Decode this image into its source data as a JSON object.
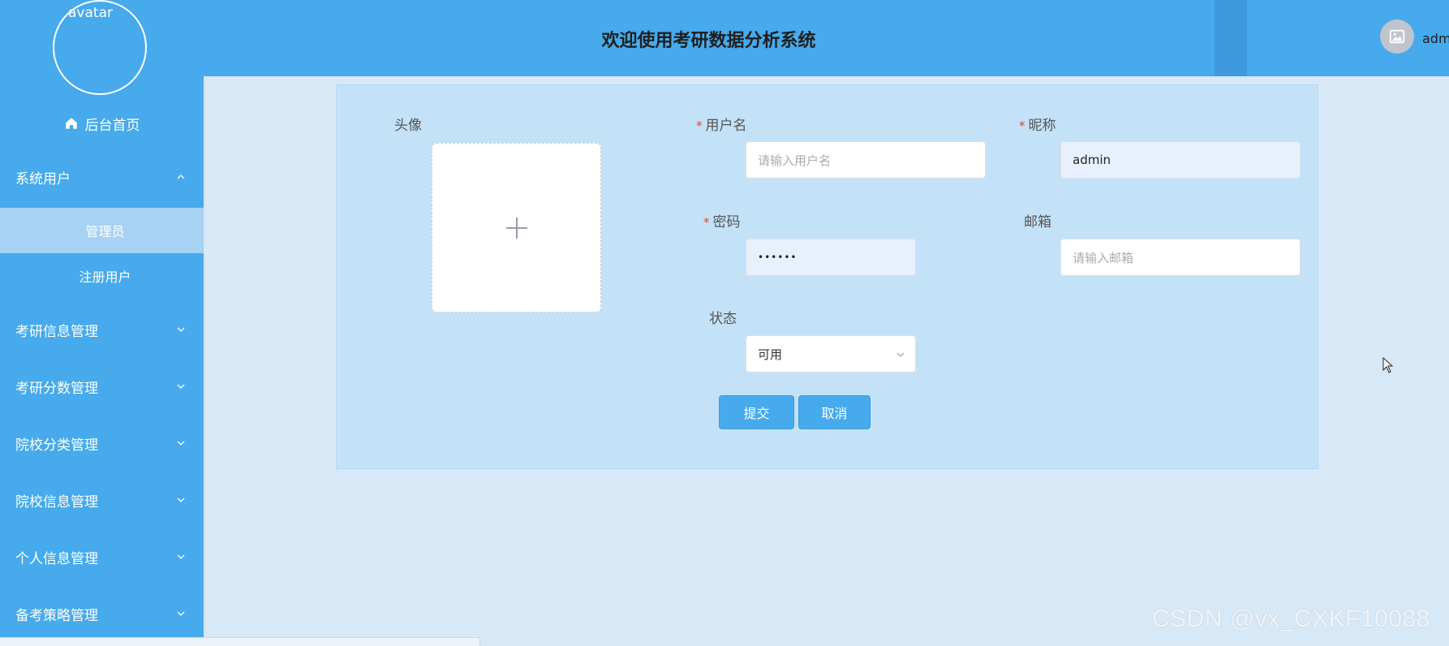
{
  "sidebar": {
    "avatar_text": "avatar",
    "home_label": "后台首页",
    "groups": [
      {
        "label": "系统用户",
        "expanded": true
      },
      {
        "label": "考研信息管理",
        "expanded": false
      },
      {
        "label": "考研分数管理",
        "expanded": false
      },
      {
        "label": "院校分类管理",
        "expanded": false
      },
      {
        "label": "院校信息管理",
        "expanded": false
      },
      {
        "label": "个人信息管理",
        "expanded": false
      },
      {
        "label": "备考策略管理",
        "expanded": false
      }
    ],
    "sub_items": [
      {
        "label": "管理员",
        "active": true
      },
      {
        "label": "注册用户",
        "active": false
      }
    ]
  },
  "header": {
    "title": "欢迎使用考研数据分析系统",
    "user_name": "admin"
  },
  "form": {
    "avatar_label": "头像",
    "username": {
      "label": "用户名",
      "required": true,
      "placeholder": "请输入用户名",
      "value": ""
    },
    "nickname": {
      "label": "昵称",
      "required": true,
      "value": "admin"
    },
    "password": {
      "label": "密码",
      "required": true,
      "value": "••••••"
    },
    "email": {
      "label": "邮箱",
      "required": false,
      "placeholder": "请输入邮箱",
      "value": ""
    },
    "status": {
      "label": "状态",
      "value": "可用"
    },
    "submit_label": "提交",
    "cancel_label": "取消"
  },
  "watermark": "CSDN @vx_CXKF10088",
  "colors": {
    "primary": "#46aaec",
    "active_submenu": "#a6d2f3",
    "panel": "#c3e2f8",
    "background": "#d7e8f6",
    "required": "#e4442c"
  }
}
